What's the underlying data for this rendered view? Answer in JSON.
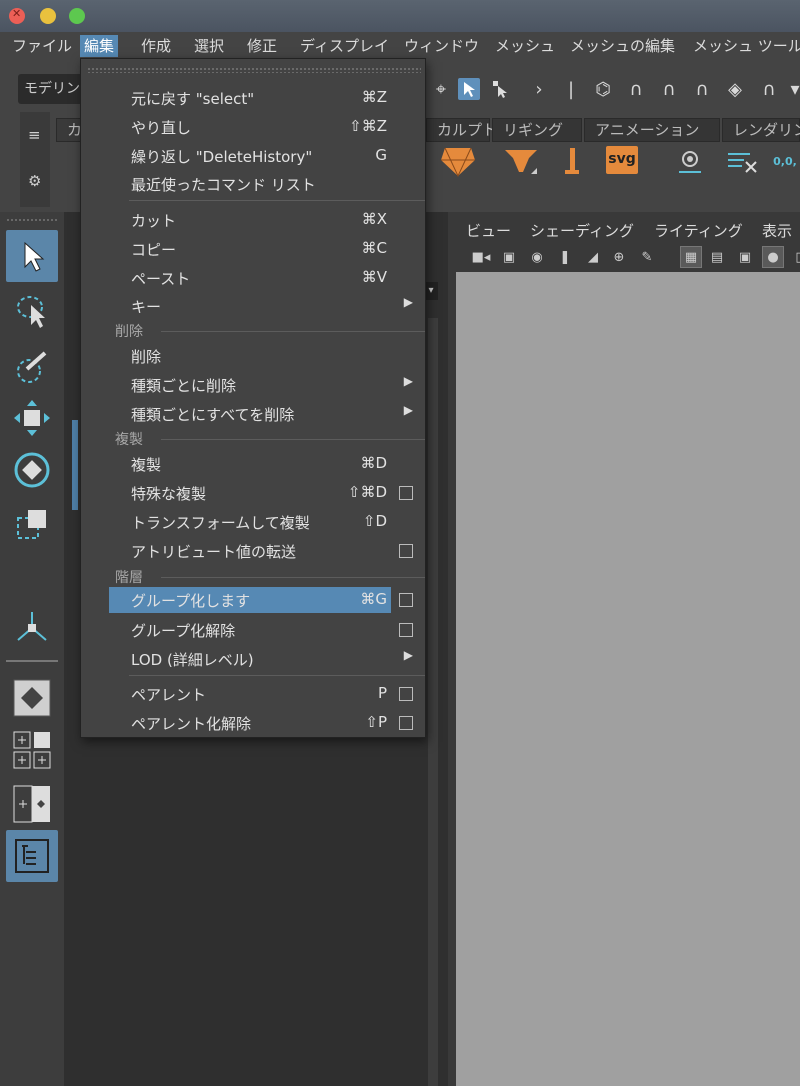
{
  "menubar": {
    "items": [
      "ファイル",
      "編集",
      "作成",
      "選択",
      "修正",
      "ディスプレイ",
      "ウィンドウ",
      "メッシュ",
      "メッシュの編集",
      "メッシュ ツール"
    ]
  },
  "toolbar": {
    "mode_label": "モデリング"
  },
  "shelf": {
    "tabs": [
      "カ",
      "カルプト",
      "リギング",
      "アニメーション",
      "レンダリン"
    ],
    "svg_label": "svg",
    "coords_label": "0,0,"
  },
  "viewport": {
    "menus": [
      "ビュー",
      "シェーディング",
      "ライティング",
      "表示"
    ]
  },
  "edit_menu": {
    "items": [
      {
        "label": "元に戻す \"select\"",
        "shortcut": "⌘Z"
      },
      {
        "label": "やり直し",
        "shortcut": "⇧⌘Z"
      },
      {
        "label": "繰り返し \"DeleteHistory\"",
        "shortcut": "G"
      },
      {
        "label": "最近使ったコマンド リスト",
        "shortcut": ""
      },
      {
        "label": "カット",
        "shortcut": "⌘X"
      },
      {
        "label": "コピー",
        "shortcut": "⌘C"
      },
      {
        "label": "ペースト",
        "shortcut": "⌘V"
      },
      {
        "label": "キー",
        "shortcut": "",
        "submenu": true
      },
      {
        "label": "削除",
        "shortcut": ""
      },
      {
        "label": "種類ごとに削除",
        "shortcut": "",
        "submenu": true
      },
      {
        "label": "種類ごとにすべてを削除",
        "shortcut": "",
        "submenu": true
      },
      {
        "label": "複製",
        "shortcut": "⌘D"
      },
      {
        "label": "特殊な複製",
        "shortcut": "⇧⌘D",
        "option_box": true
      },
      {
        "label": "トランスフォームして複製",
        "shortcut": "⇧D"
      },
      {
        "label": "アトリビュート値の転送",
        "shortcut": "",
        "option_box": true
      },
      {
        "label": "グループ化します",
        "shortcut": "⌘G",
        "option_box": true,
        "highlighted": true
      },
      {
        "label": "グループ化解除",
        "shortcut": "",
        "option_box": true
      },
      {
        "label": "LOD (詳細レベル)",
        "shortcut": "",
        "submenu": true
      },
      {
        "label": "ペアレント",
        "shortcut": "P",
        "option_box": true
      },
      {
        "label": "ペアレント化解除",
        "shortcut": "⇧P",
        "option_box": true
      }
    ],
    "sections": [
      "削除",
      "複製",
      "階層"
    ]
  },
  "colors": {
    "highlight": "#5689b4",
    "viewport_bg": "#a0a0a0",
    "menu_bg": "#434343"
  }
}
